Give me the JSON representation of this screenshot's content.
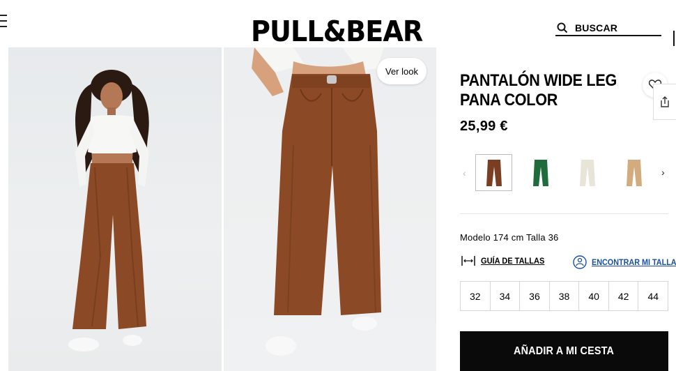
{
  "header": {
    "brand": "PULL&BEAR",
    "search_label": "BUSCAR"
  },
  "gallery": {
    "ver_look_label": "Ver look"
  },
  "product": {
    "title": "PANTALÓN WIDE LEG PANA COLOR",
    "price": "25,99 €",
    "colors": [
      {
        "name": "marrón",
        "hex": "#7a3f22",
        "selected": true
      },
      {
        "name": "verde",
        "hex": "#1f6b3c",
        "selected": false
      },
      {
        "name": "crudo",
        "hex": "#e9e4d8",
        "selected": false
      },
      {
        "name": "camel",
        "hex": "#d2ab7e",
        "selected": false
      }
    ],
    "model_info": "Modelo 174 cm Talla 36",
    "size_guide_label": "GUÍA DE TALLAS",
    "find_size_label": "ENCONTRAR MI TALLA",
    "sizes": [
      "32",
      "34",
      "36",
      "38",
      "40",
      "42",
      "44"
    ],
    "add_to_cart_label": "AÑADIR A MI CESTA"
  },
  "colors": {
    "accent_link": "#1a4fa0",
    "button_bg": "#0a0a0a",
    "product_brown": "#8b4a25"
  }
}
